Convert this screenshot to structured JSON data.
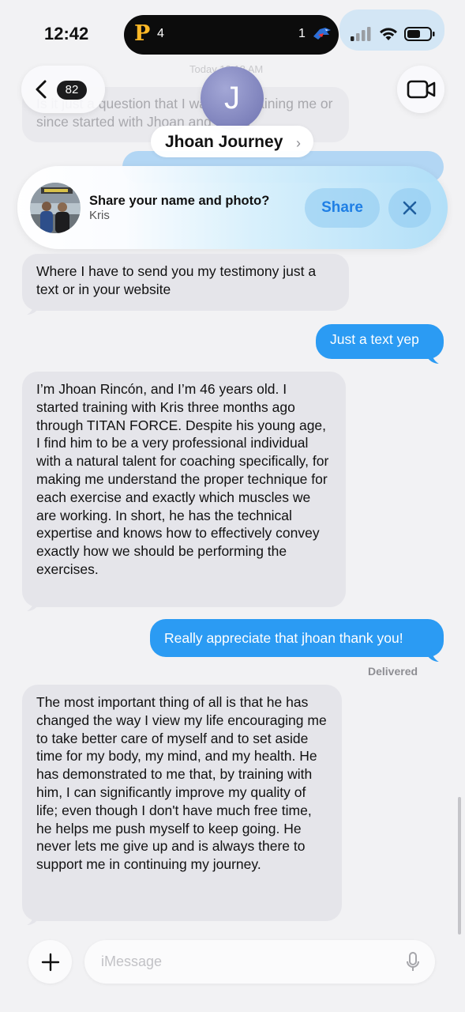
{
  "status_bar": {
    "time": "12:42",
    "live_activity": {
      "team_left_logo": "P",
      "score_left": "4",
      "score_right": "1",
      "team_right_icon": "bluejays-logo-icon"
    },
    "icons": [
      "signal-icon",
      "wifi-icon",
      "battery-icon"
    ]
  },
  "header": {
    "back_badge_count": "82",
    "timestamp": "Today 10:18 AM",
    "avatar_initial": "J",
    "contact_name": "Jhoan Journey",
    "contact_chevron": "›",
    "video_icon": "video-camera-icon"
  },
  "faded_messages": {
    "incoming_text": "Is it just a question that I want you training me or since started with Jhoan and Steve"
  },
  "share_prompt": {
    "title": "Share your name and photo?",
    "subtitle": "Kris",
    "share_label": "Share",
    "close_icon": "close-icon"
  },
  "messages": [
    {
      "direction": "incoming",
      "text": "Where I have to send you my testimony just a text or in your website"
    },
    {
      "direction": "outgoing",
      "text": "Just a text yep"
    },
    {
      "direction": "incoming",
      "text": "I’m Jhoan Rincón, and I’m 46 years old. I started training with Kris three months ago through TITAN FORCE. Despite his young age, I find him to be a very professional individual with a natural talent for coaching specifically, for making me understand the proper technique for each exercise and exactly which muscles we are working. In short, he has the technical expertise and knows how to effectively convey exactly how we should be performing the exercises."
    },
    {
      "direction": "outgoing",
      "text": "Really appreciate that jhoan thank you!"
    },
    {
      "direction": "incoming",
      "text": "The most important thing of all is that he has changed the way I view my life encouraging me to take better care of myself and to set aside time for my body, my mind, and my health. He has demonstrated to me that, by training with him, I can significantly improve my quality of life; even though I don't have much free time, he helps me push myself to keep going. He never lets me give up and is always there to support me in continuing my journey."
    }
  ],
  "delivery_status": "Delivered",
  "composer": {
    "placeholder": "iMessage",
    "value": "",
    "add_icon": "plus-icon",
    "mic_icon": "microphone-icon"
  },
  "colors": {
    "outgoing_bubble": "#2b9bf3",
    "incoming_bubble": "#e5e5ea",
    "accent": "#1f7fe5",
    "background": "#f2f2f4"
  }
}
